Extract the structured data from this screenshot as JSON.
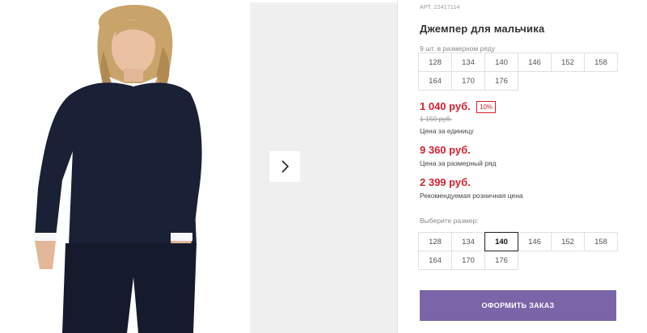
{
  "product": {
    "article": "АРТ. 22417114",
    "title": "Джемпер для мальчика",
    "row_note": "9 шт. в размерном ряду",
    "row_sizes": [
      "128",
      "134",
      "140",
      "146",
      "152",
      "158",
      "164",
      "170",
      "176"
    ],
    "price": "1 040 руб.",
    "discount": "10%",
    "old_price": "1 150 руб.",
    "unit_price_label": "Цена за единицу",
    "row_price": "9 360 руб.",
    "row_price_label": "Цена за размерный ряд",
    "rrp": "2 399 руб.",
    "rrp_label": "Рекомендуемая розничная цена",
    "choose_size_label": "Выберите размер:",
    "size_options": [
      "128",
      "134",
      "140",
      "146",
      "152",
      "158",
      "164",
      "170",
      "176"
    ],
    "selected_size": "140",
    "order_button": "ОФОРМИТЬ ЗАКАЗ"
  },
  "gallery": {
    "next_icon": "chevron-right-icon"
  },
  "colors": {
    "price_red": "#d61f2c",
    "order_button": "#7b64a8",
    "sweater_navy": "#1a2035"
  }
}
